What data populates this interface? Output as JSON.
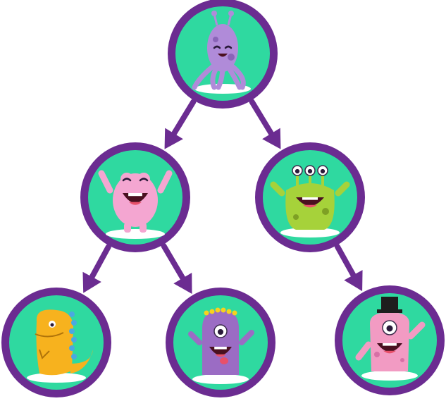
{
  "diagram": {
    "colors": {
      "ring": "#6B2C91",
      "node_fill": "#2FD9A0",
      "arrow": "#6B2C91",
      "shadow": "#FFFFFF"
    },
    "nodes": [
      {
        "id": "root",
        "icon": "purple-octopus-monster-icon",
        "color": "#B08BD9"
      },
      {
        "id": "left",
        "icon": "pink-fluffy-monster-icon",
        "color": "#F4A6D1"
      },
      {
        "id": "right",
        "icon": "green-three-eyed-monster-icon",
        "color": "#A6D23A"
      },
      {
        "id": "left-left",
        "icon": "orange-dinosaur-monster-icon",
        "color": "#F7B21E"
      },
      {
        "id": "left-right",
        "icon": "purple-spiky-monster-icon",
        "color": "#9B6CC4"
      },
      {
        "id": "right-right",
        "icon": "pink-cyclops-top-hat-monster-icon",
        "color": "#F29BC3"
      }
    ],
    "edges": [
      {
        "from": "root",
        "to": "left"
      },
      {
        "from": "root",
        "to": "right"
      },
      {
        "from": "left",
        "to": "left-left"
      },
      {
        "from": "left",
        "to": "left-right"
      },
      {
        "from": "right",
        "to": "right-right"
      }
    ]
  }
}
